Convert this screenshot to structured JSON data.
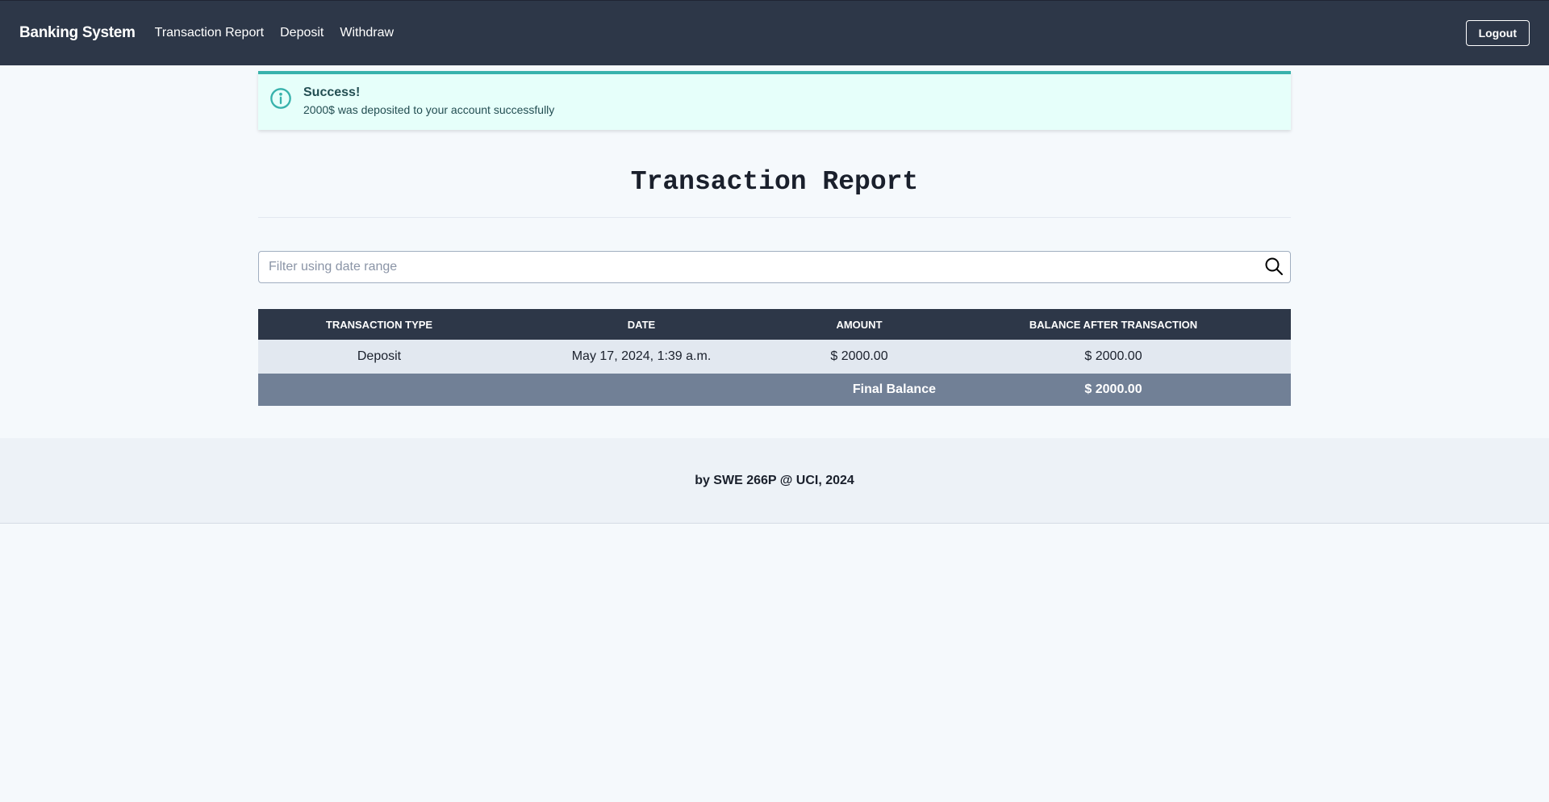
{
  "navbar": {
    "brand": "Banking System",
    "links": [
      "Transaction Report",
      "Deposit",
      "Withdraw"
    ],
    "logout_label": "Logout"
  },
  "alert": {
    "icon": "info-circle-icon",
    "title": "Success!",
    "message": "2000$ was deposited to your account successfully"
  },
  "page": {
    "title": "Transaction Report"
  },
  "search": {
    "placeholder": "Filter using date range",
    "value": "",
    "icon": "search-icon"
  },
  "table": {
    "headers": [
      "TRANSACTION TYPE",
      "DATE",
      "AMOUNT",
      "BALANCE AFTER TRANSACTION"
    ],
    "rows": [
      {
        "type": "Deposit",
        "date": "May 17, 2024, 1:39 a.m.",
        "amount": "$ 2000.00",
        "balance": "$ 2000.00"
      }
    ],
    "final_label": "Final Balance",
    "final_balance": "$ 2000.00"
  },
  "footer": {
    "text": "by SWE 266P @ UCI, 2024"
  },
  "colors": {
    "navbar": "#2d3748",
    "alert_bg": "#e6fffa",
    "alert_accent": "#38b2ac",
    "total_row": "#718096",
    "data_row": "#e2e8f0"
  }
}
